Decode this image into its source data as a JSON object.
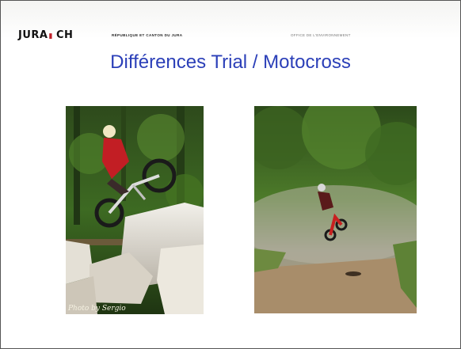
{
  "header": {
    "brand_left": "JURA",
    "brand_sep": " CH",
    "republic": "RÉPUBLIQUE ET CANTON DU JURA",
    "office": "OFFICE DE L'ENVIRONNEMENT"
  },
  "slide": {
    "title": "Différences Trial / Motocross"
  },
  "photos": {
    "trial": {
      "credit": "Photo by Sergio"
    }
  }
}
